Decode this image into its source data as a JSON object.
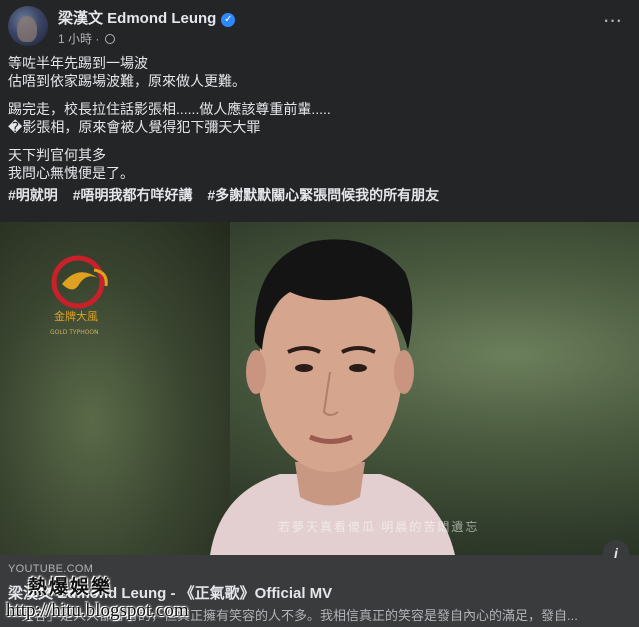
{
  "header": {
    "author_name": "梁漢文 Edmond Leung",
    "time": "1 小時",
    "separator": "·"
  },
  "post": {
    "paragraphs": [
      [
        "等咗半年先踢到一場波",
        "估唔到依家踢場波難，原來做人更難。"
      ],
      [
        "踢完走，校長拉住話影張相......做人應該尊重前輩.....",
        "�影張相，原來會被人覺得犯下彌天大罪"
      ],
      [
        "天下判官何其多",
        "我問心無愧便是了。"
      ]
    ],
    "hashtags": [
      "#明就明",
      "#唔明我都冇咩好講",
      "#多謝默默關心緊張問候我的所有朋友"
    ]
  },
  "video": {
    "logo_text": "金牌大風",
    "logo_subtext": "GOLD TYPHOON",
    "subtitle": "若夢天真看傻瓜  明晨的苦悶遺忘",
    "info_symbol": "i"
  },
  "link_card": {
    "domain": "YOUTUBE.COM",
    "title": "梁漢文 Edmond Leung - 《正氣歌》Official MV",
    "description": "「笑容」是人人都會有的，但真正擁有笑容的人不多。我相信真正的笑容是發自內心的滿足，發自..."
  },
  "watermark": {
    "line1": "熱爆娛樂",
    "line2": "http://hitu.blogspot.com"
  },
  "colors": {
    "background": "#242526",
    "text": "#e4e6eb",
    "secondary_text": "#b0b3b8",
    "verified": "#2d88ff",
    "card": "#3a3b3c"
  }
}
